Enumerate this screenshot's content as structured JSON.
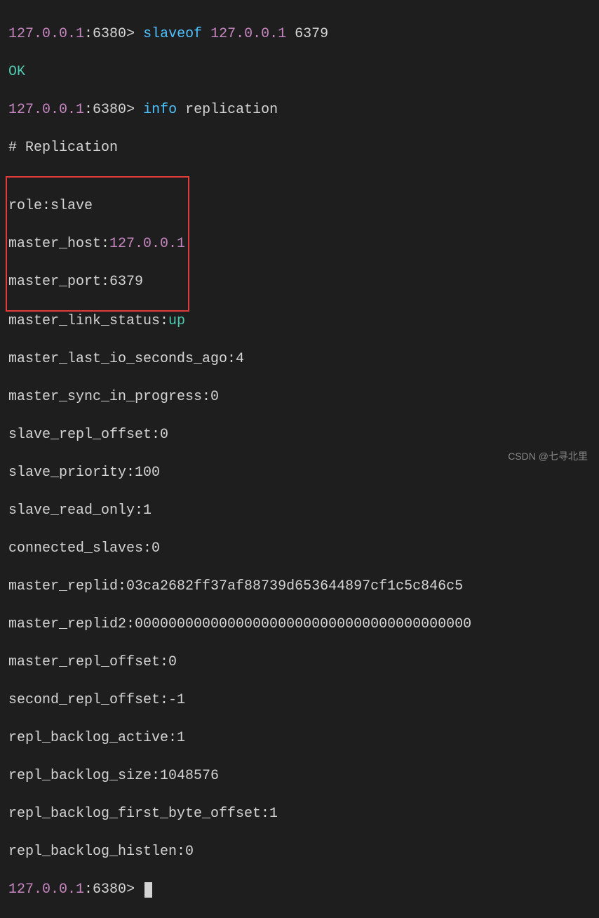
{
  "prompt": {
    "host": "127.0.0.1",
    "port": "6380",
    "sep": ":",
    "gt": "> "
  },
  "cmd1": {
    "keyword": "slaveof",
    "arg_host": "127.0.0.1",
    "arg_port": "6379"
  },
  "ok": "OK",
  "cmd2": {
    "keyword": "info",
    "arg": "replication"
  },
  "replication_header": "# Replication",
  "boxed": {
    "role_key": "role:",
    "role_val": "slave",
    "mhost_key": "master_host:",
    "mhost_val": "127.0.0.1",
    "mport_key": "master_port:",
    "mport_val": "6379"
  },
  "lines": {
    "mlink_key": "master_link_status:",
    "mlink_val": "up",
    "l1": "master_last_io_seconds_ago:4",
    "l2": "master_sync_in_progress:0",
    "l3": "slave_repl_offset:0",
    "l4": "slave_priority:100",
    "l5": "slave_read_only:1",
    "l6": "connected_slaves:0",
    "l7": "master_replid:03ca2682ff37af88739d653644897cf1c5c846c5",
    "l8": "master_replid2:0000000000000000000000000000000000000000",
    "l9": "master_repl_offset:0",
    "l10": "second_repl_offset:-1",
    "l11": "repl_backlog_active:1",
    "l12": "repl_backlog_size:1048576",
    "l13": "repl_backlog_first_byte_offset:1",
    "l14": "repl_backlog_histlen:0"
  },
  "watermark": "CSDN @七寻北里"
}
